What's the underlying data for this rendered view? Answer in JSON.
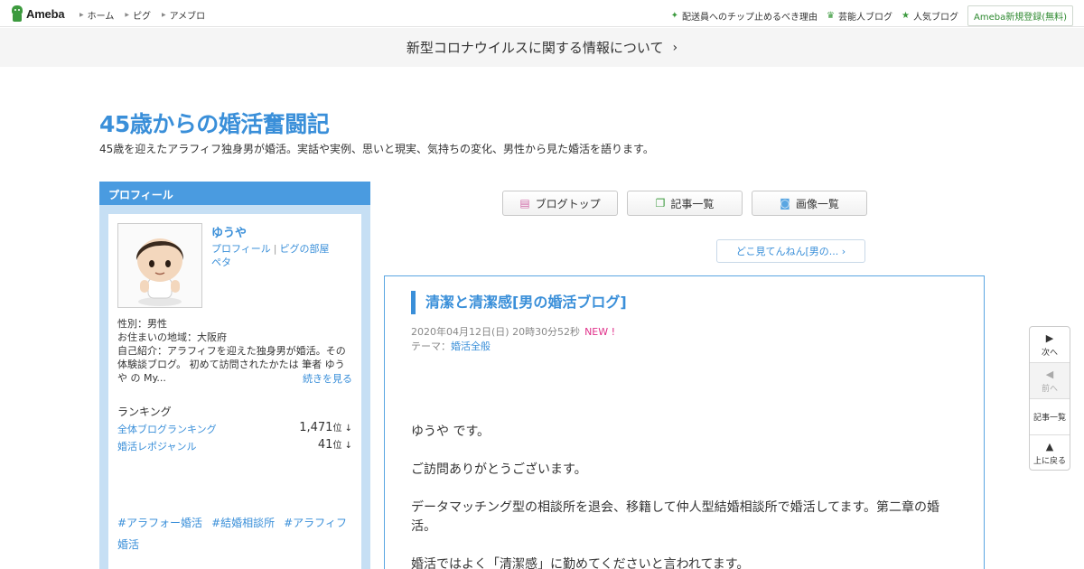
{
  "topbar": {
    "logo_text": "Ameba",
    "nav": [
      "ホーム",
      "ピグ",
      "アメブロ"
    ],
    "right_links": [
      {
        "icon": "sparkle-icon",
        "label": "配送員へのチップ止めるべき理由"
      },
      {
        "icon": "crown-icon",
        "label": "芸能人ブログ"
      },
      {
        "icon": "star-icon",
        "label": "人気ブログ"
      }
    ],
    "signup_label": "Ameba新規登録(無料)"
  },
  "notice": {
    "text": "新型コロナウイルスに関する情報について"
  },
  "blog": {
    "title": "45歳からの婚活奮闘記",
    "description": "45歳を迎えたアラフィフ独身男が婚活。実話や実例、思いと現実、気持ちの変化、男性から見た婚活を語ります。"
  },
  "profile": {
    "heading": "プロフィール",
    "name": "ゆうや",
    "link_profile": "プロフィール",
    "link_pig": "ピグの部屋",
    "peta": "ペタ",
    "gender": "性別：男性",
    "area": "お住まいの地域：大阪府",
    "intro": "自己紹介：アラフィフを迎えた独身男が婚活。その体験談ブログ。 初めて訪問されたかたは 筆者 ゆうや の My...",
    "more": "続きを見る",
    "ranking_title": "ランキング",
    "rankings": [
      {
        "label": "全体ブログランキング",
        "value": "1,471",
        "unit": "位 ↓"
      },
      {
        "label": "婚活レポジャンル",
        "value": "41",
        "unit": "位 ↓"
      }
    ],
    "tags": [
      "#アラフォー婚活",
      "#結婚相談所",
      "#アラフィフ婚活"
    ]
  },
  "buttons": {
    "blog_top": "ブログトップ",
    "article_list": "記事一覧",
    "image_list": "画像一覧"
  },
  "next_article": "どこ見てんねん[男の...",
  "article": {
    "title": "清潔と清潔感[男の婚活ブログ]",
    "date": "2020年04月12日(日) 20時30分52秒",
    "new_badge": "NEW !",
    "theme_label": "テーマ：",
    "theme": "婚活全般",
    "paragraphs": [
      "ゆうや です。",
      "ご訪問ありがとうございます。",
      "データマッチング型の相談所を退会、移籍して仲人型結婚相談所で婚活してます。第二章の婚活。",
      "婚活ではよく「清潔感」に勤めてくださいと言われてます。"
    ]
  },
  "floatnav": {
    "next": "次へ",
    "prev": "前へ",
    "list": "記事一覧",
    "top": "上に戻る"
  },
  "colors": {
    "accent_blue": "#3a8fd9",
    "ameba_green": "#3c9a3e",
    "new_pink": "#e0308a"
  }
}
